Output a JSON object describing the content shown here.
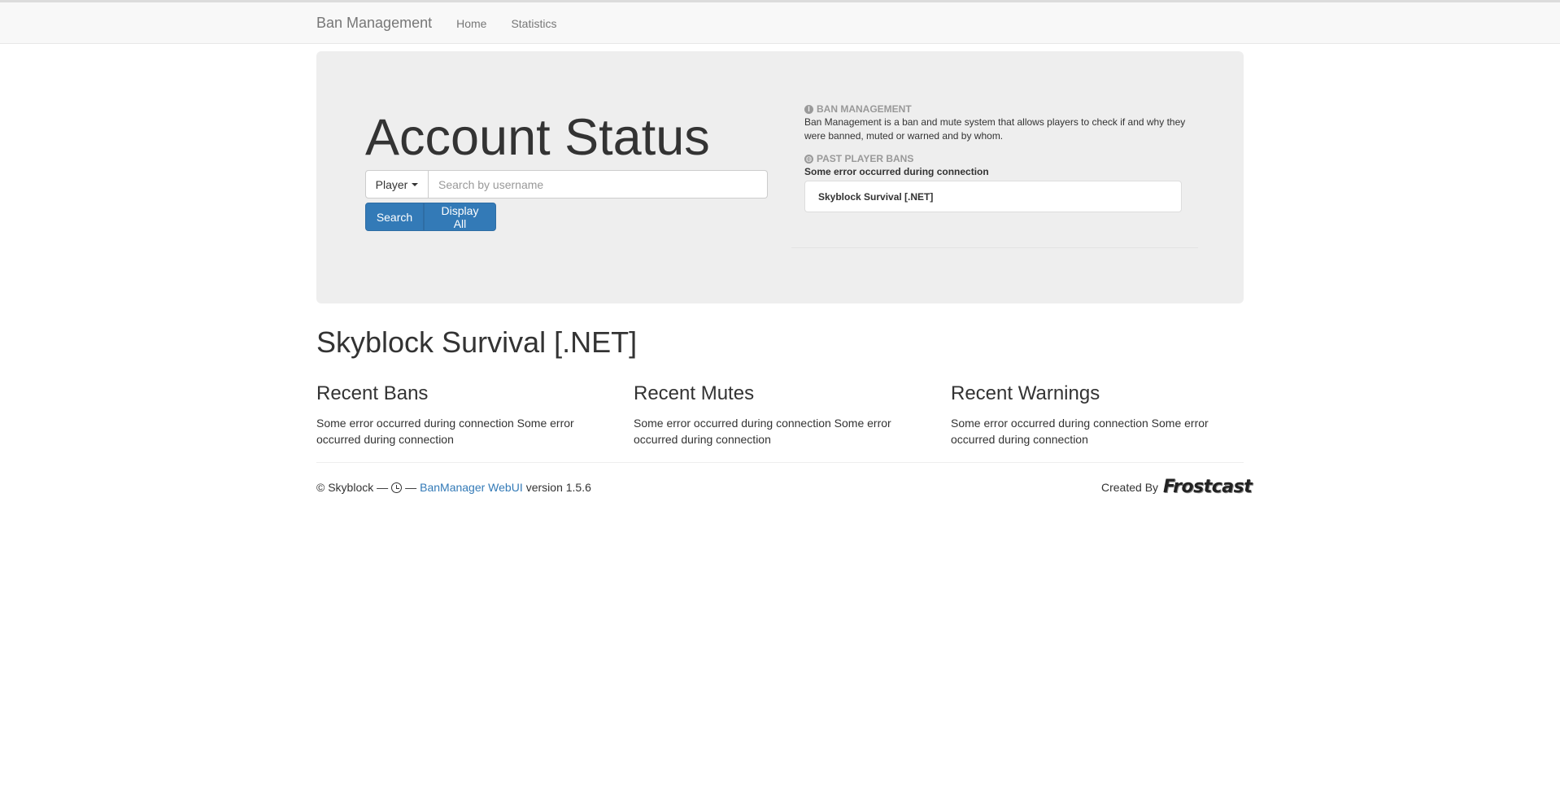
{
  "navbar": {
    "brand": "Ban Management",
    "links": [
      "Home",
      "Statistics"
    ]
  },
  "jumbotron": {
    "title": "Account Status",
    "search": {
      "type_label": "Player",
      "placeholder": "Search by username",
      "value": ""
    },
    "buttons": {
      "search": "Search",
      "display_all": "Display All"
    },
    "info": {
      "ban_heading": "BAN MANAGEMENT",
      "ban_text": "Ban Management is a ban and mute system that allows players to check if and why they were banned, muted or warned and by whom.",
      "past_heading": "PAST PLAYER BANS",
      "error": "Some error occurred during connection",
      "server_item": "Skyblock Survival [.NET]"
    }
  },
  "server": {
    "title": "Skyblock Survival [.NET]",
    "columns": [
      {
        "title": "Recent Bans",
        "text": "Some error occurred during connection Some error occurred during connection"
      },
      {
        "title": "Recent Mutes",
        "text": "Some error occurred during connection Some error occurred during connection"
      },
      {
        "title": "Recent Warnings",
        "text": "Some error occurred during connection Some error occurred during connection"
      }
    ]
  },
  "footer": {
    "copyright": "© Skyblock —",
    "dash": "—",
    "link_text": "BanManager WebUI",
    "version": "version 1.5.6",
    "created_by": "Created By",
    "logo_text": "Frostcast"
  },
  "colors": {
    "primary": "#337ab7",
    "jumbotron_bg": "#eeeeee",
    "navbar_bg": "#f8f8f8"
  }
}
